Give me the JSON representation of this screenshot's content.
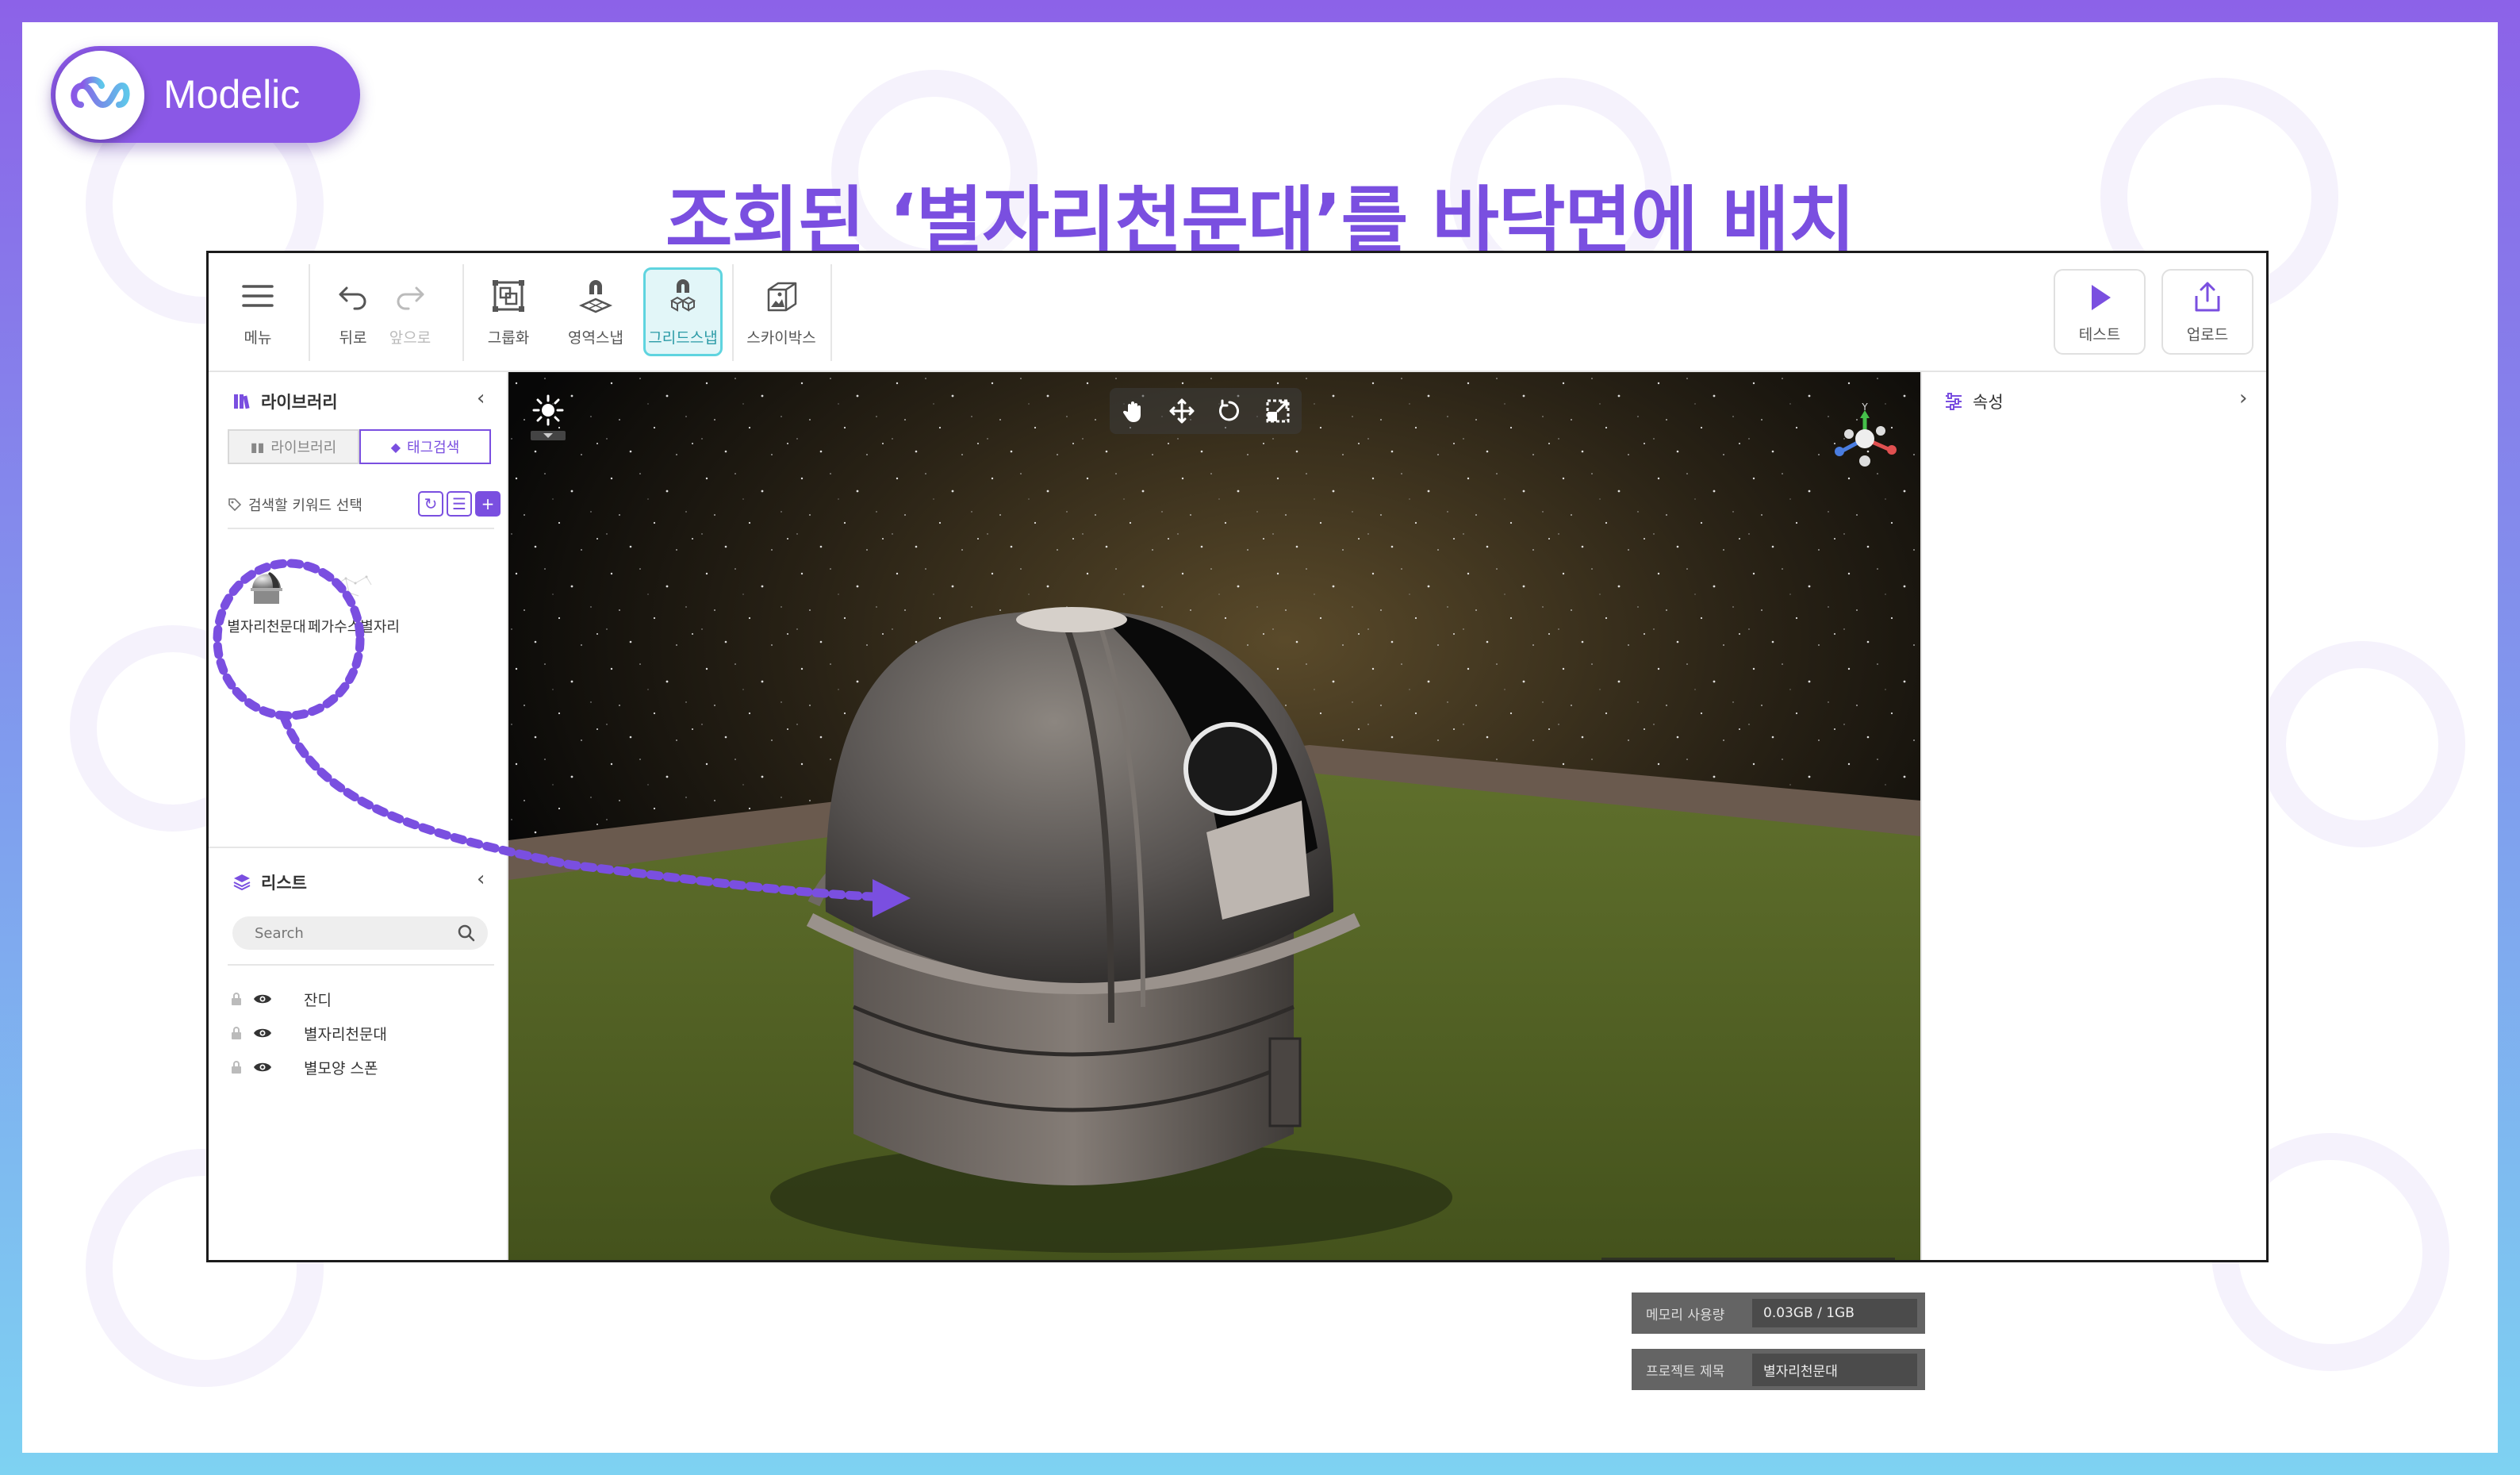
{
  "brand": {
    "name": "Modelic"
  },
  "headline": "조회된 ‘별자리천문대’를 바닥면에 배치",
  "toolbar": {
    "menu": "메뉴",
    "undo": "뒤로",
    "redo": "앞으로",
    "group": "그룹화",
    "area_snap": "영역스냅",
    "grid_snap": "그리드스냅",
    "skybox": "스카이박스",
    "test": "테스트",
    "upload": "업로드"
  },
  "library": {
    "title": "라이브러리",
    "tabs": [
      "라이브러리",
      "태그검색"
    ],
    "selected_tab": "태그검색",
    "keyword_label": "검색할 키워드 선택",
    "items": [
      {
        "name": "별자리천문대",
        "icon": "observatory-thumbnail"
      },
      {
        "name": "페가수스별자리",
        "icon": "constellation-thumbnail"
      }
    ]
  },
  "list": {
    "title": "리스트",
    "search_placeholder": "Search",
    "items": [
      "잔디",
      "별자리천문대",
      "별모양 스폰"
    ]
  },
  "properties": {
    "title": "속성"
  },
  "viewport": {
    "memory_label": "메모리 사용량",
    "memory_value": "0.03GB / 1GB",
    "project_label": "프로젝트 제목",
    "project_value": "별자리천문대",
    "gizmo_axis": "Y"
  },
  "colors": {
    "brand_purple": "#7a4fe0",
    "active_cyan": "#5fd4df",
    "annotation_purple": "#7a4fe0"
  }
}
